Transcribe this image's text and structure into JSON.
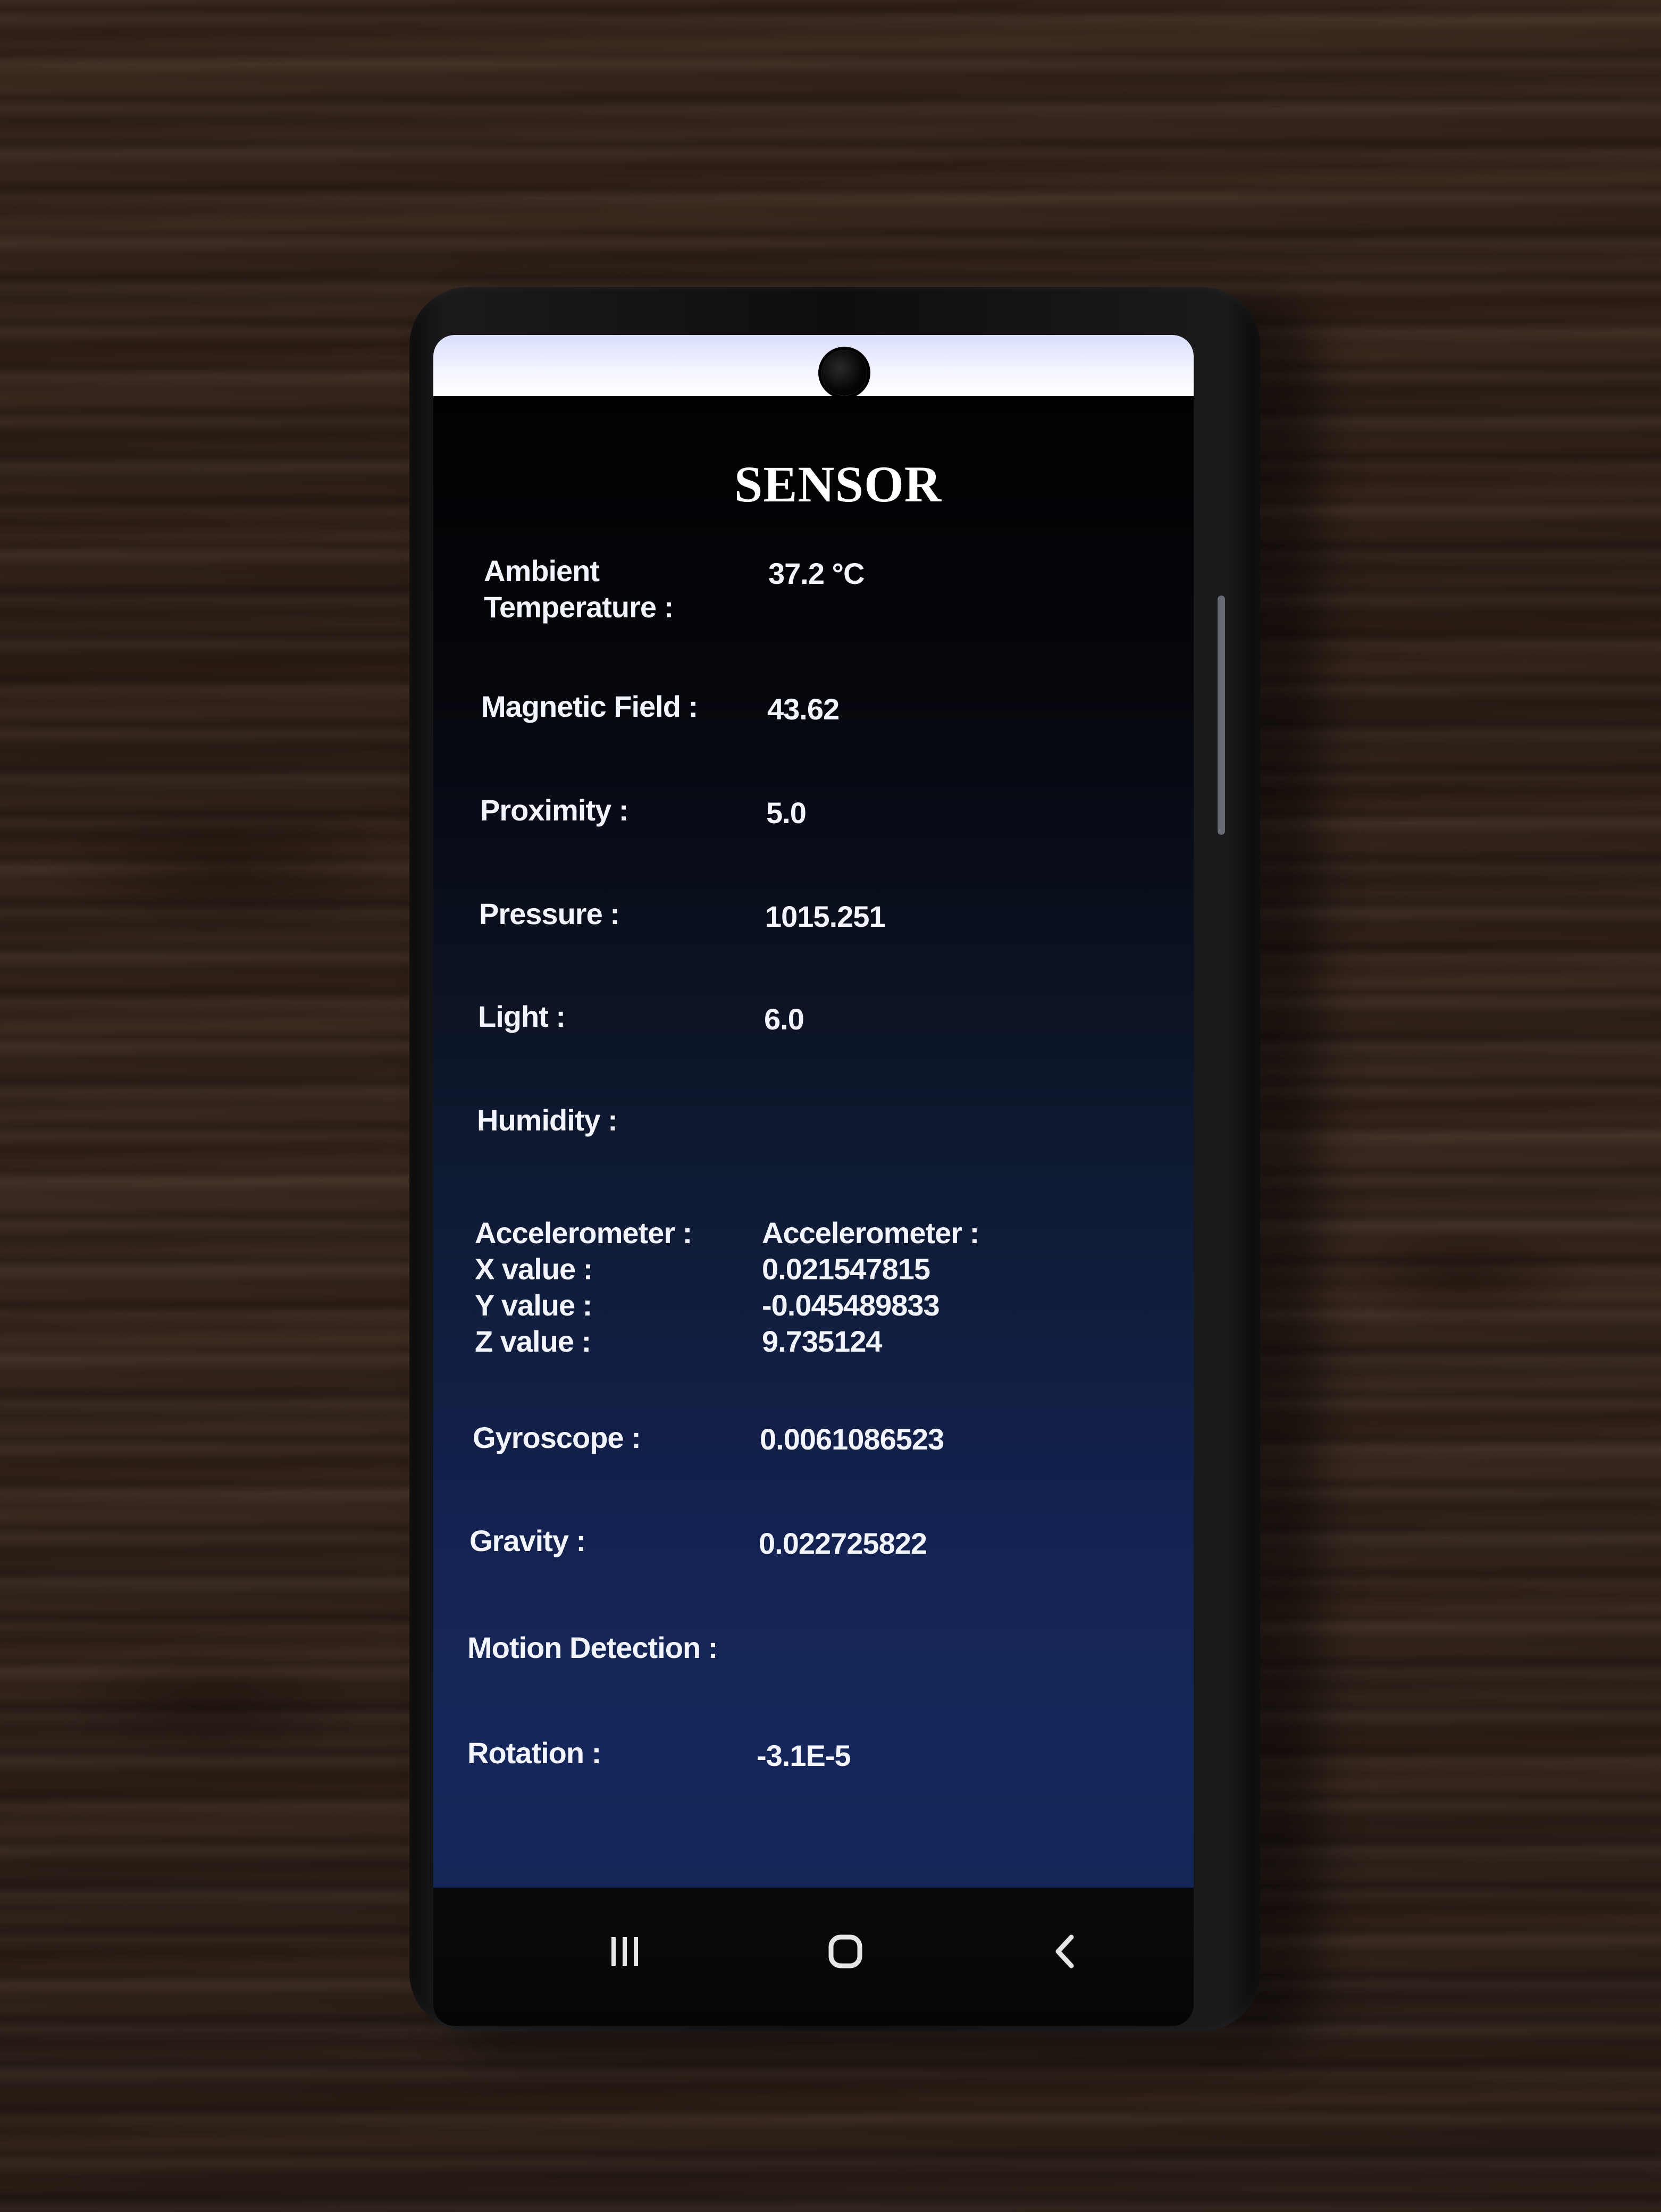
{
  "app": {
    "title": "SENSOR"
  },
  "sensors": [
    {
      "label": "Ambient\nTemperature :",
      "value": "37.2 °C"
    },
    {
      "label": "Magnetic Field :",
      "value": "43.62"
    },
    {
      "label": "Proximity :",
      "value": "5.0"
    },
    {
      "label": "Pressure :",
      "value": "1015.251"
    },
    {
      "label": "Light :",
      "value": "6.0"
    },
    {
      "label": "Humidity :",
      "value": ""
    },
    {
      "label": "Accelerometer :\nX value :\nY value :\nZ value :",
      "value": "Accelerometer :\n0.021547815\n-0.045489833\n9.735124"
    },
    {
      "label": "Gyroscope :",
      "value": "0.0061086523"
    },
    {
      "label": "Gravity :",
      "value": "0.022725822"
    },
    {
      "label": "Motion Detection :",
      "value": ""
    },
    {
      "label": "Rotation :",
      "value": "-3.1E-5"
    }
  ],
  "navbar": {
    "recents_icon": "recents-icon",
    "home_icon": "home-icon",
    "back_icon": "back-icon"
  },
  "colors": {
    "screen_top": "#000000",
    "screen_bottom": "#15275a",
    "text": "#f2f4ff",
    "status_bar": "#f4f5ff"
  }
}
